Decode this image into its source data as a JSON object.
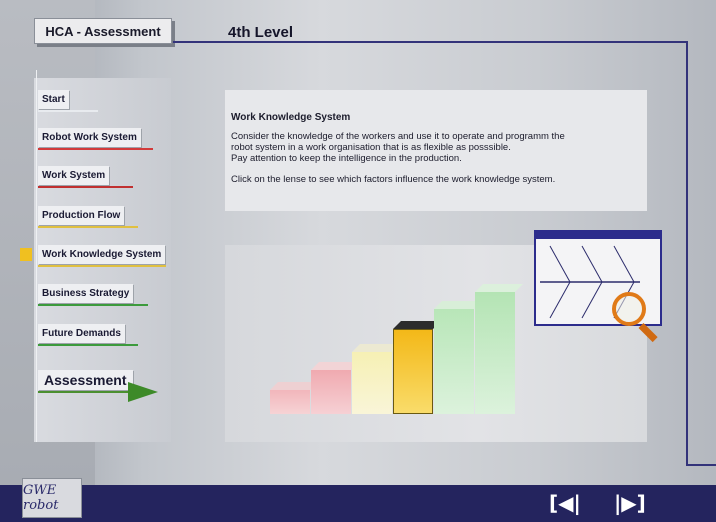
{
  "header": {
    "app_title": "HCA - Assessment",
    "page_heading": "4th Level"
  },
  "sidebar": {
    "items": [
      {
        "label": "Start",
        "underline_color": "#e8ebef"
      },
      {
        "label": "Robot Work System",
        "underline_color": "#d23a3a"
      },
      {
        "label": "Work System",
        "underline_color": "#c03030"
      },
      {
        "label": "Production Flow",
        "underline_color": "#e0c040"
      },
      {
        "label": "Work Knowledge System",
        "underline_color": "#e0c040",
        "active": true
      },
      {
        "label": "Business Strategy",
        "underline_color": "#3c9a3c"
      },
      {
        "label": "Future Demands",
        "underline_color": "#3c9a3c"
      }
    ],
    "assessment_label": "Assessment"
  },
  "info": {
    "title": "Work Knowledge System",
    "paragraph1_line1": "Consider the knowledge of the workers and use it to operate and programm the",
    "paragraph1_line2": "robot system in a work organisation that is as flexible as posssible.",
    "paragraph1_line3": "Pay attention to keep the intelligence in the production.",
    "paragraph2": "Click on the lense to see which factors influence the work knowledge system."
  },
  "footer": {
    "logo_text": "GWE robot",
    "prev_label": "[◀|",
    "next_label": "|▶]"
  },
  "colors": {
    "accent_navy": "#24245e",
    "active_marker": "#f0c020",
    "assessment_arrow": "#3d8a28",
    "lens_orange": "#e07a18"
  }
}
